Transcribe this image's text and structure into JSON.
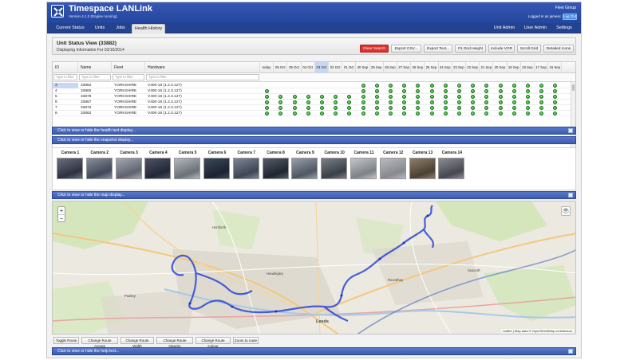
{
  "header": {
    "title": "Timespace LANLink",
    "version": "Version 4.1.0 (Engine running)",
    "company": "Fleet Group",
    "login_info": "Logged in as jamesc",
    "logout_label": "Log Out"
  },
  "nav": {
    "left": [
      "Current Status",
      "Units",
      "Jobs",
      "Health History"
    ],
    "active": "Health History",
    "right": [
      "Unit Admin",
      "User Admin",
      "Settings"
    ]
  },
  "unit_status": {
    "title": "Unit Status View (33882)",
    "subtitle": "Displaying Information For 03/10/2014",
    "buttons": [
      "Clear Search",
      "Export CSV...",
      "Export Text...",
      "Fit Grid Height",
      "Include VOR",
      "Scroll Grid",
      "Detailed Icons"
    ]
  },
  "grid": {
    "columns": [
      "ID",
      "Name",
      "Fleet",
      "Hardware"
    ],
    "dates": [
      "today",
      "06 Oct",
      "05 Oct",
      "04 Oct",
      "03 Oct",
      "02 Oct",
      "01 Oct",
      "30 Sep",
      "29 Sep",
      "28 Sep",
      "27 Sep",
      "26 Sep",
      "25 Sep",
      "24 Sep",
      "23 Sep",
      "22 Sep",
      "21 Sep",
      "20 Sep",
      "19 Sep",
      "18 Sep",
      "17 Sep",
      "16 Sep"
    ],
    "selected_date": "03 Oct",
    "filter_placeholder": "Type to filter",
    "rows": [
      {
        "id": "3",
        "name": "33882",
        "fleet": "YORKSHIRE",
        "hardware": "V400-16 (1.2.3.127)",
        "dots": [
          0,
          0,
          0,
          0,
          0,
          0,
          0,
          1,
          1,
          1,
          1,
          1,
          1,
          1,
          1,
          1,
          1,
          1,
          1,
          1,
          1,
          1
        ]
      },
      {
        "id": "4",
        "name": "33860",
        "fleet": "YORKSHIRE",
        "hardware": "V400-16 (1.2.3.127)",
        "dots": [
          1,
          0,
          0,
          0,
          0,
          0,
          0,
          1,
          1,
          1,
          1,
          1,
          1,
          1,
          1,
          1,
          1,
          1,
          1,
          1,
          1,
          1
        ]
      },
      {
        "id": "5",
        "name": "33878",
        "fleet": "YORKSHIRE",
        "hardware": "V400-16 (1.2.3.127)",
        "dots": [
          1,
          1,
          1,
          1,
          1,
          1,
          1,
          1,
          1,
          1,
          1,
          1,
          1,
          1,
          1,
          1,
          1,
          1,
          1,
          1,
          1,
          1
        ]
      },
      {
        "id": "6",
        "name": "33867",
        "fleet": "YORKSHIRE",
        "hardware": "V400-16 (1.2.3.127)",
        "dots": [
          1,
          1,
          1,
          1,
          1,
          1,
          1,
          1,
          1,
          1,
          1,
          1,
          1,
          1,
          1,
          1,
          1,
          1,
          1,
          1,
          1,
          1
        ]
      },
      {
        "id": "7",
        "name": "33876",
        "fleet": "YORKSHIRE",
        "hardware": "V400-16 (1.2.3.127)",
        "dots": [
          1,
          1,
          1,
          1,
          1,
          1,
          1,
          1,
          1,
          1,
          1,
          1,
          1,
          1,
          1,
          1,
          1,
          1,
          1,
          1,
          1,
          1
        ]
      },
      {
        "id": "8",
        "name": "33862",
        "fleet": "YORKSHIRE",
        "hardware": "V400-16 (1.2.3.127)",
        "dots": [
          1,
          1,
          1,
          1,
          1,
          1,
          1,
          1,
          1,
          1,
          1,
          1,
          1,
          1,
          1,
          1,
          1,
          1,
          1,
          1,
          1,
          1
        ]
      }
    ]
  },
  "sections": {
    "health_text": "Click to view or hide the health text display...",
    "snapshot": "Click to view or hide the snapshot display...",
    "map": "Click to view or hide the map display...",
    "help": "Click to view or hide the help text..."
  },
  "cameras": [
    "Camera 1",
    "Camera 2",
    "Camera 3",
    "Camera 4",
    "Camera 5",
    "Camera 6",
    "Camera 7",
    "Camera 8",
    "Camera 9",
    "Camera 10",
    "Camera 11",
    "Camera 12",
    "Camera 13",
    "Camera 14"
  ],
  "map": {
    "attribution": "Leaflet | Map data © OpenStreetMap contributors",
    "zoom_in": "+",
    "zoom_out": "−",
    "labels": [
      "Leeds",
      "Headingley",
      "Roundhay",
      "Seacroft",
      "Pudsey",
      "Horsforth"
    ]
  },
  "route_buttons": [
    "Toggle Route",
    "Change Route Arrows",
    "Change Route Width",
    "Change Route Opacity",
    "Change Route Colour",
    "Zoom to route"
  ],
  "colors": {
    "header": "#25469e",
    "section_bar": "#3d5cb1",
    "ok_dot": "#1b9a1b",
    "route": "#2a47d6",
    "clear_button": "#d9322f"
  }
}
